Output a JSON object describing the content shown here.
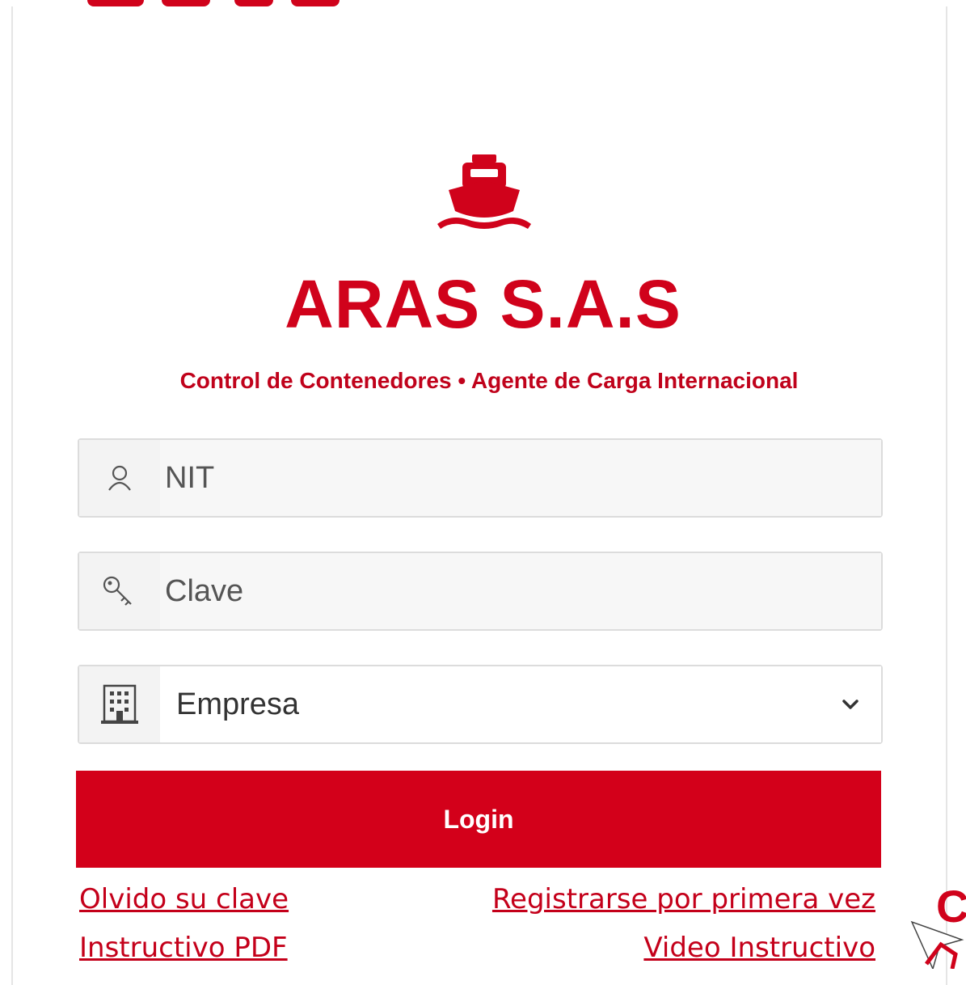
{
  "brand": {
    "name": "ARAS S.A.S",
    "tagline": "Control de Contenedores • Agente de Carga Internacional",
    "logo_icon": "ship-icon",
    "accent_color": "#d0021b"
  },
  "form": {
    "nit": {
      "placeholder": "NIT",
      "icon": "user-icon"
    },
    "clave": {
      "placeholder": "Clave",
      "icon": "key-icon"
    },
    "empresa": {
      "selected": "Empresa",
      "icon": "building-icon"
    },
    "login_label": "Login"
  },
  "links": {
    "forgot": "Olvido su clave",
    "register": "Registrarse por primera vez",
    "pdf": "Instructivo PDF",
    "video": "Video Instructivo"
  },
  "corner_fragment": "C"
}
